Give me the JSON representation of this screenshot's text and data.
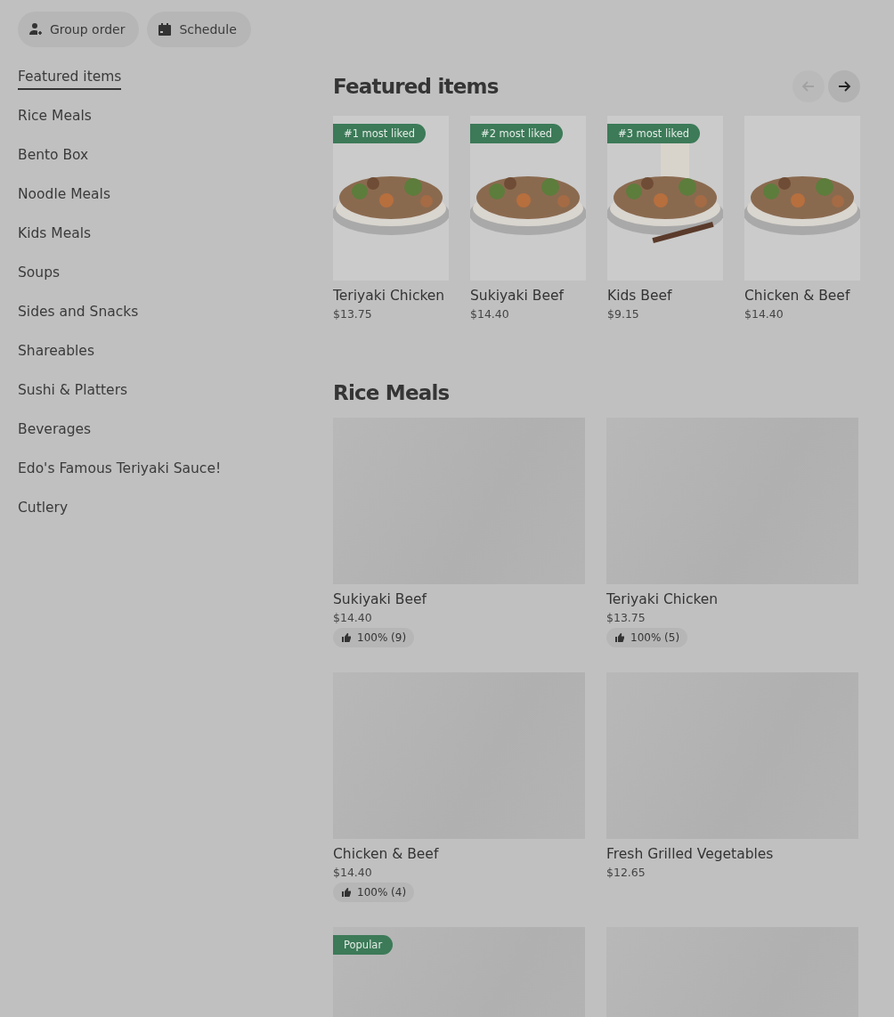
{
  "actions": [
    {
      "kind": "group",
      "label": "Group order"
    },
    {
      "kind": "schedule",
      "label": "Schedule"
    }
  ],
  "sidebar": {
    "items": [
      {
        "label": "Featured items",
        "selected": true
      },
      {
        "label": "Rice Meals",
        "selected": false
      },
      {
        "label": "Bento Box",
        "selected": false
      },
      {
        "label": "Noodle Meals",
        "selected": false
      },
      {
        "label": "Kids Meals",
        "selected": false
      },
      {
        "label": "Soups",
        "selected": false
      },
      {
        "label": "Sides and Snacks",
        "selected": false
      },
      {
        "label": "Shareables",
        "selected": false
      },
      {
        "label": "Sushi & Platters",
        "selected": false
      },
      {
        "label": "Beverages",
        "selected": false
      },
      {
        "label": "Edo's Famous Teriyaki Sauce!",
        "selected": false
      },
      {
        "label": "Cutlery",
        "selected": false
      }
    ]
  },
  "featured": {
    "title": "Featured items",
    "prev": {
      "disabled": true
    },
    "next": {
      "disabled": false
    },
    "items": [
      {
        "badge": "#1 most liked",
        "name": "Teriyaki Chicken",
        "price": "$13.75"
      },
      {
        "badge": "#2 most liked",
        "name": "Sukiyaki Beef",
        "price": "$14.40"
      },
      {
        "badge": "#3 most liked",
        "name": "Kids Beef",
        "price": "$9.15"
      },
      {
        "name": "Chicken & Beef",
        "price": "$14.40"
      }
    ]
  },
  "rice_meals": {
    "title": "Rice Meals",
    "items": [
      {
        "image": {
          "kind": "placeholder"
        },
        "name": "Sukiyaki Beef",
        "price": "$14.40",
        "rating": "100% (9)"
      },
      {
        "image": {
          "kind": "placeholder"
        },
        "name": "Teriyaki Chicken",
        "price": "$13.75",
        "rating": "100% (5)"
      },
      {
        "image": {
          "kind": "placeholder"
        },
        "name": "Chicken & Beef",
        "price": "$14.40",
        "rating": "100% (4)"
      },
      {
        "image": {
          "kind": "placeholder"
        },
        "name": "Fresh Grilled Vegetables",
        "price": "$12.65"
      },
      {
        "image": {
          "kind": "placeholder"
        },
        "badge": "Popular"
      },
      {
        "image": {
          "kind": "placeholder"
        }
      }
    ]
  }
}
